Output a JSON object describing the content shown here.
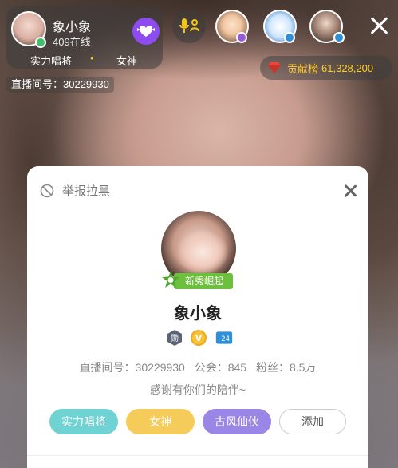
{
  "host": {
    "name": "象小象",
    "online": "409在线",
    "tags": [
      "实力唱将",
      "女神"
    ]
  },
  "contribution": {
    "label": "贡献榜",
    "value": "61,328,200"
  },
  "room": {
    "label": "直播间号：30229930"
  },
  "modal": {
    "report": "举报拉黑",
    "level_label": "新秀崛起",
    "name": "象小象",
    "badges": [
      "勋",
      "V",
      "24"
    ],
    "stats": {
      "room": "直播间号：30229930",
      "guild": "公会：845",
      "fans": "粉丝：8.5万"
    },
    "motto": "感谢有你们的陪伴~",
    "tags": [
      "实力唱将",
      "女神",
      "古风仙侠"
    ],
    "add_label": "添加"
  },
  "colors": {
    "follow": "#8d4bf0",
    "tag_teal": "#6fd3d3",
    "tag_yellow": "#f5cb5a",
    "tag_purple": "#9a86e6",
    "level_green": "#6dbf3e",
    "gold": "#ffcc33"
  },
  "icons": {
    "follow": "heart-wings-icon",
    "mic": "mic-link-icon",
    "close": "close-icon",
    "gem": "gem-icon",
    "report": "ban-icon"
  }
}
